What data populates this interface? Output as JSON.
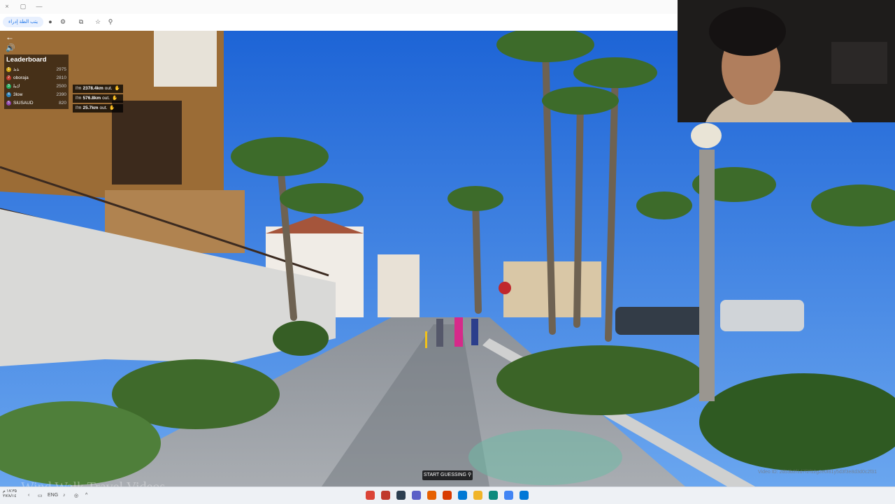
{
  "browser": {
    "window_buttons": [
      "×",
      "▢",
      "—"
    ],
    "url_pill": "يتب الطة إدراء",
    "toolbar_icons": [
      "info-icon",
      "settings-icon",
      "share-icon",
      "star-icon",
      "extension-icon"
    ]
  },
  "game": {
    "back_icon": "←",
    "sound_icon": "🔊",
    "leaderboard": {
      "title": "Leaderboard",
      "rows": [
        {
          "rank": "1",
          "name": "ﺬﺑﺫ",
          "score": "2975",
          "color": "#d4a817"
        },
        {
          "rank": "2",
          "name": "oboraja",
          "score": "2810",
          "color": "#c0392b"
        },
        {
          "rank": "3",
          "name": "ﻙﺒﻟ",
          "score": "2500",
          "color": "#27ae60"
        },
        {
          "rank": "4",
          "name": "3low",
          "score": "2390",
          "color": "#2980b9"
        },
        {
          "rank": "5",
          "name": "SiUSAUD",
          "score": "820",
          "color": "#8e44ad"
        }
      ]
    },
    "out_messages": [
      {
        "prefix": "I'm",
        "distance": "2378.4km",
        "suffix": "out."
      },
      {
        "prefix": "I'm",
        "distance": "576.8km",
        "suffix": "out."
      },
      {
        "prefix": "I'm",
        "distance": "25.7km",
        "suffix": "out."
      }
    ],
    "start_guessing": "START GUESSING",
    "video_id": "Video ID: 2d53b2f1d7f2f12g2e0f81y5d3f3e8d3d0c2f31",
    "watermark": "Wind Walk Travel Videos"
  },
  "taskbar": {
    "date": "١٧:٣٥ م",
    "date2": "٢٧/٨/١٤",
    "lang": "ENG",
    "apps": [
      {
        "name": "chrome-icon",
        "color": "#db4437"
      },
      {
        "name": "app-icon",
        "color": "#c0392b"
      },
      {
        "name": "terminal-icon",
        "color": "#2c3e50"
      },
      {
        "name": "teams-icon",
        "color": "#5b5fc7"
      },
      {
        "name": "firefox-icon",
        "color": "#e66000"
      },
      {
        "name": "office-icon",
        "color": "#d83b01"
      },
      {
        "name": "mail-icon",
        "color": "#0078d4"
      },
      {
        "name": "folder-icon",
        "color": "#f0b429"
      },
      {
        "name": "edge-icon",
        "color": "#0c8a7d"
      },
      {
        "name": "photos-icon",
        "color": "#4285f4"
      },
      {
        "name": "windows-icon",
        "color": "#0078d7"
      }
    ]
  },
  "colors": {
    "sky": "#1f6fe0",
    "building": "#9a6b34",
    "wall": "#d8d8d6",
    "path": "#9ba0a6"
  }
}
